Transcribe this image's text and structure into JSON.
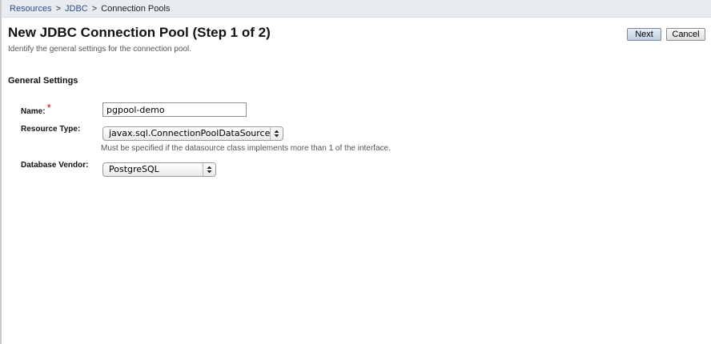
{
  "breadcrumb": {
    "items": [
      "Resources",
      "JDBC"
    ],
    "separator": ">",
    "current": "Connection Pools"
  },
  "page": {
    "title": "New JDBC Connection Pool (Step 1 of 2)",
    "help_text": "Identify the general settings for the connection pool."
  },
  "buttons": {
    "next_label": "Next",
    "cancel_label": "Cancel"
  },
  "general_settings": {
    "section_title": "General Settings",
    "name": {
      "label": "Name:",
      "required_marker": "*",
      "value": "pgpool-demo"
    },
    "resource_type": {
      "label": "Resource Type:",
      "selected": "javax.sql.ConnectionPoolDataSource",
      "help": "Must be specified if the datasource class implements more than 1 of the interface."
    },
    "database_vendor": {
      "label": "Database Vendor:",
      "selected": "PostgreSQL"
    }
  },
  "icons": {
    "required": "asterisk-icon",
    "select_arrows": "updown-chevron-icon"
  },
  "colors": {
    "breadcrumb_bg": "#e9ecef",
    "link": "#2a4d8f",
    "required": "#cc0000",
    "next_button": "#bfcfe0"
  }
}
